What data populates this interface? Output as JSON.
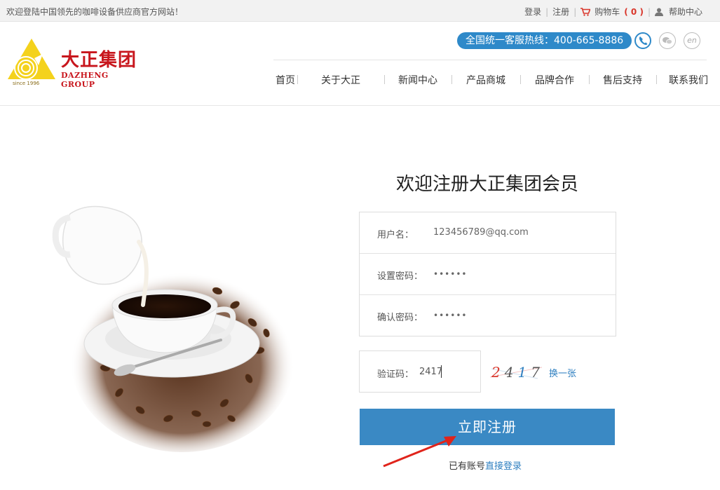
{
  "topbar": {
    "welcome": "欢迎登陆中国领先的咖啡设备供应商官方网站！",
    "login": "登录",
    "register": "注册",
    "cart_label": "购物车",
    "cart_count": "( 0 )",
    "help": "帮助中心",
    "separator": "|"
  },
  "logo": {
    "name_cn": "大正集团",
    "name_en": "DAZHENG GROUP",
    "since": "since 1996"
  },
  "header": {
    "hotline": "全国统一客服热线：400-665-8886",
    "en_label": "en"
  },
  "nav": [
    "首页",
    "关于大正",
    "新闻中心",
    "产品商城",
    "品牌合作",
    "售后支持",
    "联系我们"
  ],
  "form": {
    "title": "欢迎注册大正集团会员",
    "username_label": "用户名：",
    "username_value": "123456789@qq.com",
    "password_label": "设置密码：",
    "password_value": "••••••",
    "confirm_label": "确认密码：",
    "confirm_value": "••••••",
    "captcha_label": "验证码：",
    "captcha_value": "2417",
    "captcha_image_text": "2417",
    "captcha_refresh": "换一张",
    "submit": "立即注册",
    "login_tip": "已有账号",
    "login_link": "直接登录"
  },
  "colors": {
    "accent": "#2e89c9",
    "brand_red": "#c8161d",
    "submit_bg": "#3a89c4",
    "arrow": "#e0241b"
  }
}
